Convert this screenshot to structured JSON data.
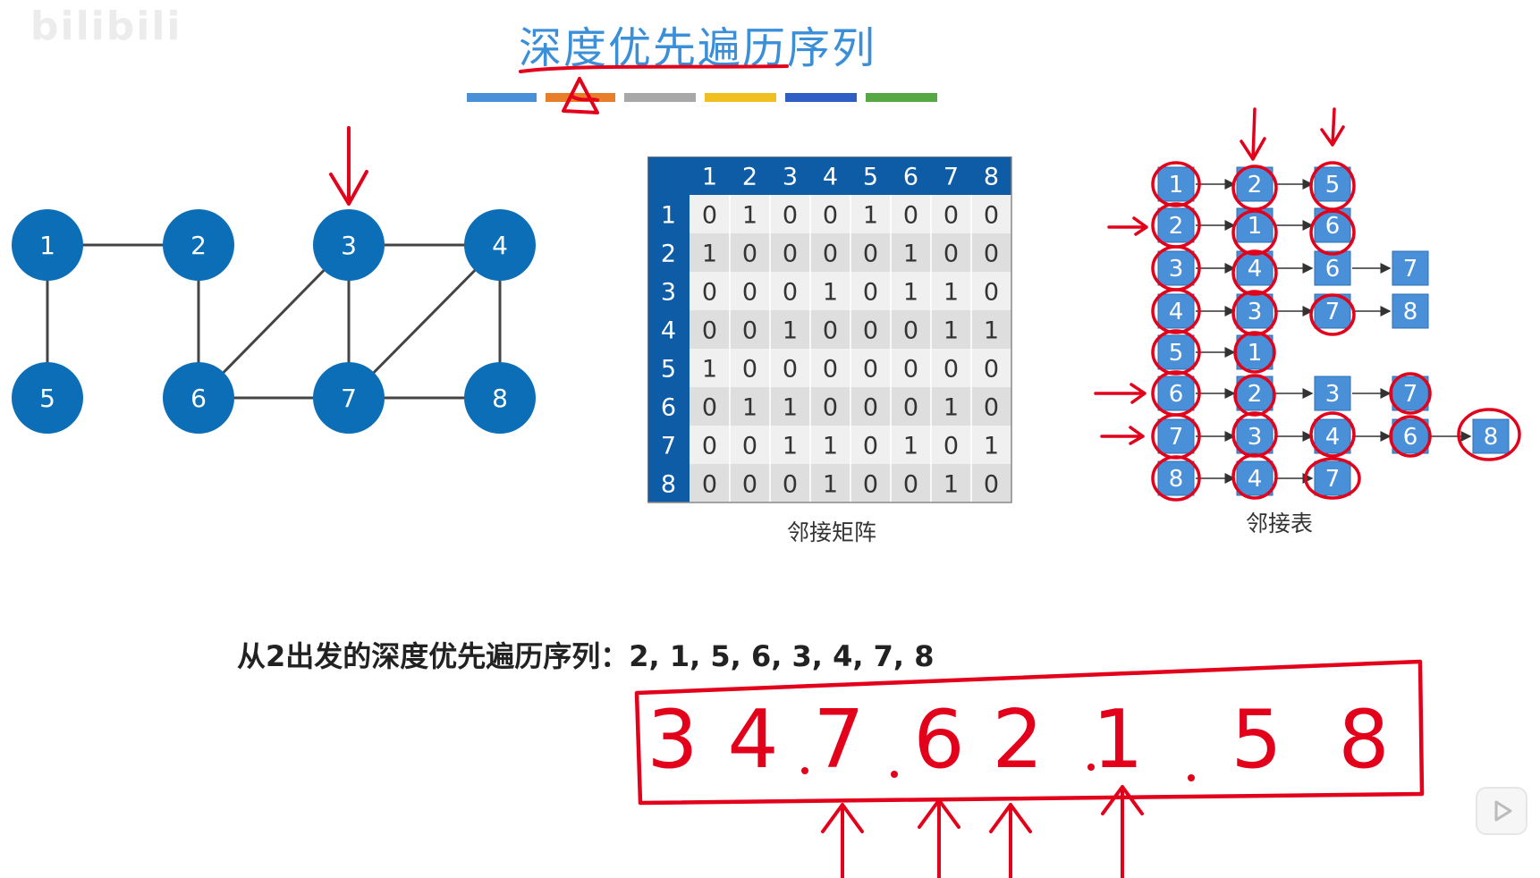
{
  "watermark": "bilibili",
  "title": "深度优先遍历序列",
  "palette": {
    "node_fill": "#0b6eb6",
    "node_text": "#ffffff",
    "edge": "#444444",
    "matrix_header": "#0e5ca6",
    "matrix_row_even": "#f0f0f0",
    "matrix_row_odd": "#dedede",
    "list_cell": "#4a90d9",
    "annotation": "#e3001b"
  },
  "color_bars": [
    "#4a90d9",
    "#e87d2a",
    "#a8a8a8",
    "#f0c020",
    "#2f5fc4",
    "#56a844"
  ],
  "graph": {
    "nodes": [
      "1",
      "2",
      "3",
      "4",
      "5",
      "6",
      "7",
      "8"
    ],
    "edges": [
      [
        "1",
        "2"
      ],
      [
        "1",
        "5"
      ],
      [
        "2",
        "6"
      ],
      [
        "3",
        "4"
      ],
      [
        "3",
        "6"
      ],
      [
        "3",
        "7"
      ],
      [
        "4",
        "7"
      ],
      [
        "4",
        "8"
      ],
      [
        "6",
        "7"
      ],
      [
        "7",
        "8"
      ]
    ]
  },
  "matrix": {
    "caption": "邻接矩阵",
    "headers": [
      "1",
      "2",
      "3",
      "4",
      "5",
      "6",
      "7",
      "8"
    ],
    "rows": [
      {
        "label": "1",
        "cells": [
          "0",
          "1",
          "0",
          "0",
          "1",
          "0",
          "0",
          "0"
        ]
      },
      {
        "label": "2",
        "cells": [
          "1",
          "0",
          "0",
          "0",
          "0",
          "1",
          "0",
          "0"
        ]
      },
      {
        "label": "3",
        "cells": [
          "0",
          "0",
          "0",
          "1",
          "0",
          "1",
          "1",
          "0"
        ]
      },
      {
        "label": "4",
        "cells": [
          "0",
          "0",
          "1",
          "0",
          "0",
          "0",
          "1",
          "1"
        ]
      },
      {
        "label": "5",
        "cells": [
          "1",
          "0",
          "0",
          "0",
          "0",
          "0",
          "0",
          "0"
        ]
      },
      {
        "label": "6",
        "cells": [
          "0",
          "1",
          "1",
          "0",
          "0",
          "0",
          "1",
          "0"
        ]
      },
      {
        "label": "7",
        "cells": [
          "0",
          "0",
          "1",
          "1",
          "0",
          "1",
          "0",
          "1"
        ]
      },
      {
        "label": "8",
        "cells": [
          "0",
          "0",
          "0",
          "1",
          "0",
          "0",
          "1",
          "0"
        ]
      }
    ]
  },
  "adjacency_list": {
    "caption": "邻接表",
    "rows": [
      {
        "head": "1",
        "neighbors": [
          "2",
          "5"
        ]
      },
      {
        "head": "2",
        "neighbors": [
          "1",
          "6"
        ]
      },
      {
        "head": "3",
        "neighbors": [
          "4",
          "6",
          "7"
        ]
      },
      {
        "head": "4",
        "neighbors": [
          "3",
          "7",
          "8"
        ]
      },
      {
        "head": "5",
        "neighbors": [
          "1"
        ]
      },
      {
        "head": "6",
        "neighbors": [
          "2",
          "3",
          "7"
        ]
      },
      {
        "head": "7",
        "neighbors": [
          "3",
          "4",
          "6",
          "8"
        ]
      },
      {
        "head": "8",
        "neighbors": [
          "4",
          "7"
        ]
      }
    ]
  },
  "result": {
    "label": "从2出发的深度优先遍历序列：",
    "sequence": "2, 1, 5, 6, 3, 4, 7, 8"
  },
  "handwritten": {
    "sequence": [
      "3",
      "4",
      "7",
      "6",
      "2",
      "1",
      "5",
      "8"
    ]
  }
}
